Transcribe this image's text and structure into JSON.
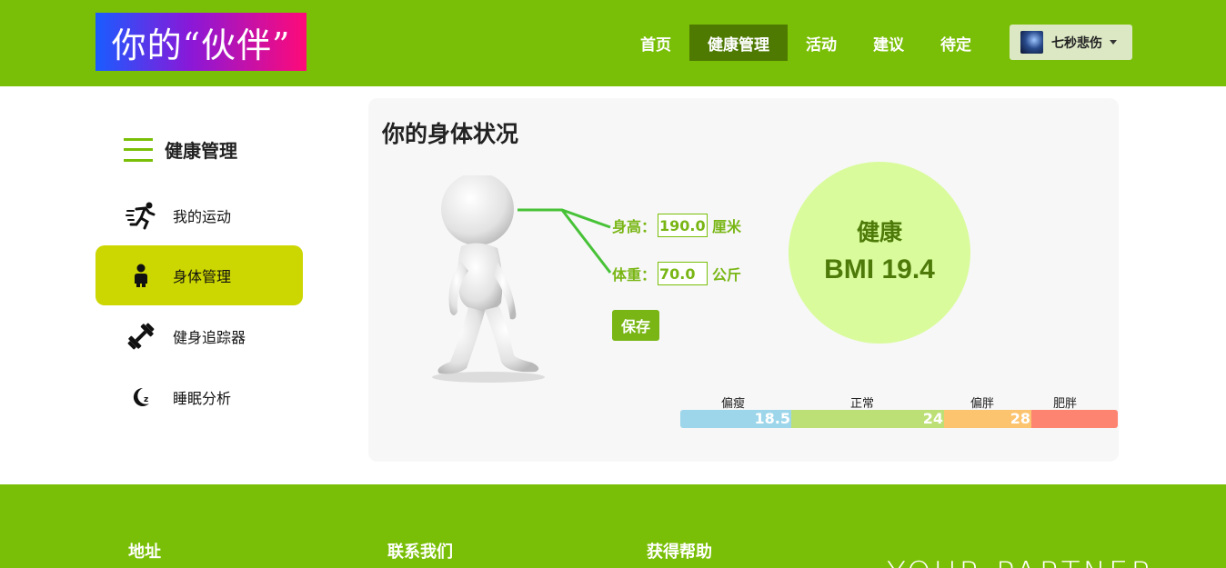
{
  "header": {
    "logo_text": "你的“伙伴”",
    "nav": [
      {
        "label": "首页"
      },
      {
        "label": "健康管理"
      },
      {
        "label": "活动"
      },
      {
        "label": "建议"
      },
      {
        "label": "待定"
      }
    ],
    "user": {
      "name": "七秒悲伤"
    }
  },
  "sidebar": {
    "title": "健康管理",
    "items": [
      {
        "label": "我的运动",
        "icon": "running-icon"
      },
      {
        "label": "身体管理",
        "icon": "person-icon"
      },
      {
        "label": "健身追踪器",
        "icon": "dumbbell-icon"
      },
      {
        "label": "睡眠分析",
        "icon": "moon-icon"
      }
    ]
  },
  "main": {
    "title": "你的身体状况",
    "height_label": "身高：",
    "height_value": "190.0",
    "height_unit": "厘米",
    "weight_label": "体重：",
    "weight_value": "70.0",
    "weight_unit": "公斤",
    "save_label": "保存",
    "bmi_status": "健康",
    "bmi_text": "BMI 19.4",
    "scale": {
      "labels": [
        "偏瘦",
        "正常",
        "偏胖",
        "肥胖"
      ],
      "thresholds": [
        "18.5",
        "24",
        "28"
      ],
      "colors": [
        "#9dd6ea",
        "#bde076",
        "#fcc46f",
        "#fd8471"
      ]
    }
  },
  "footer": {
    "columns": [
      "地址",
      "联系我们",
      "获得帮助"
    ],
    "tagline": "YOUR PARTNER"
  },
  "colors": {
    "brand_green": "#7abf07",
    "nav_active": "#4e7a02",
    "sidebar_active": "#ccd600",
    "bmi_circle": "#d9fb9c",
    "bmi_text": "#4d7a08"
  }
}
